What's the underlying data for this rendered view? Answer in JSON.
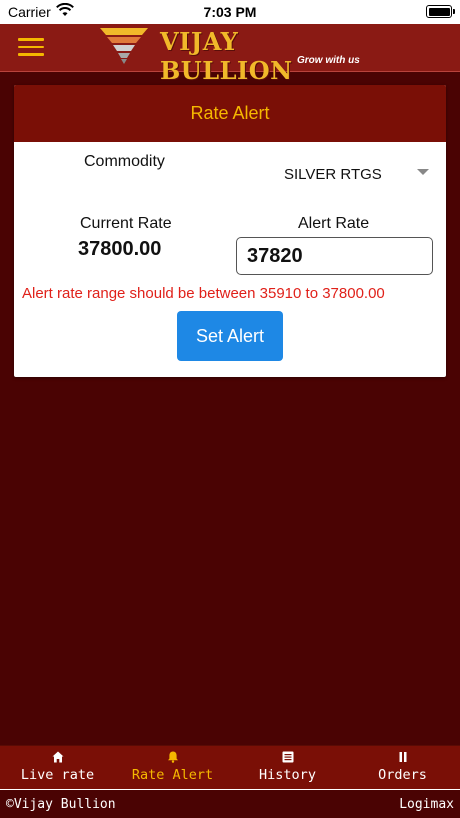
{
  "status_bar": {
    "carrier": "Carrier",
    "time": "7:03 PM"
  },
  "header": {
    "brand": "VIJAY BULLION",
    "tagline": "Grow with us",
    "menu_icon": "hamburger-menu-icon",
    "accent_color": "#f5b800",
    "background_color": "#8a1a14"
  },
  "rate_alert": {
    "title": "Rate Alert",
    "commodity_label": "Commodity",
    "commodity_value": "SILVER RTGS",
    "current_rate_label": "Current Rate",
    "current_rate_value": "37800.00",
    "alert_rate_label": "Alert Rate",
    "alert_rate_value": "37820",
    "error_message": "Alert rate range should be between 35910 to 37800.00",
    "error_color": "#e0211a",
    "set_alert_label": "Set Alert",
    "button_color": "#1e88e5"
  },
  "bottom_nav": {
    "items": [
      {
        "label": "Live rate",
        "icon": "home-icon",
        "active": false
      },
      {
        "label": "Rate Alert",
        "icon": "bell-icon",
        "active": true
      },
      {
        "label": "History",
        "icon": "list-icon",
        "active": false
      },
      {
        "label": "Orders",
        "icon": "pause-icon",
        "active": false
      }
    ]
  },
  "footer": {
    "copyright": "©Vijay Bullion",
    "vendor": "Logimax"
  }
}
